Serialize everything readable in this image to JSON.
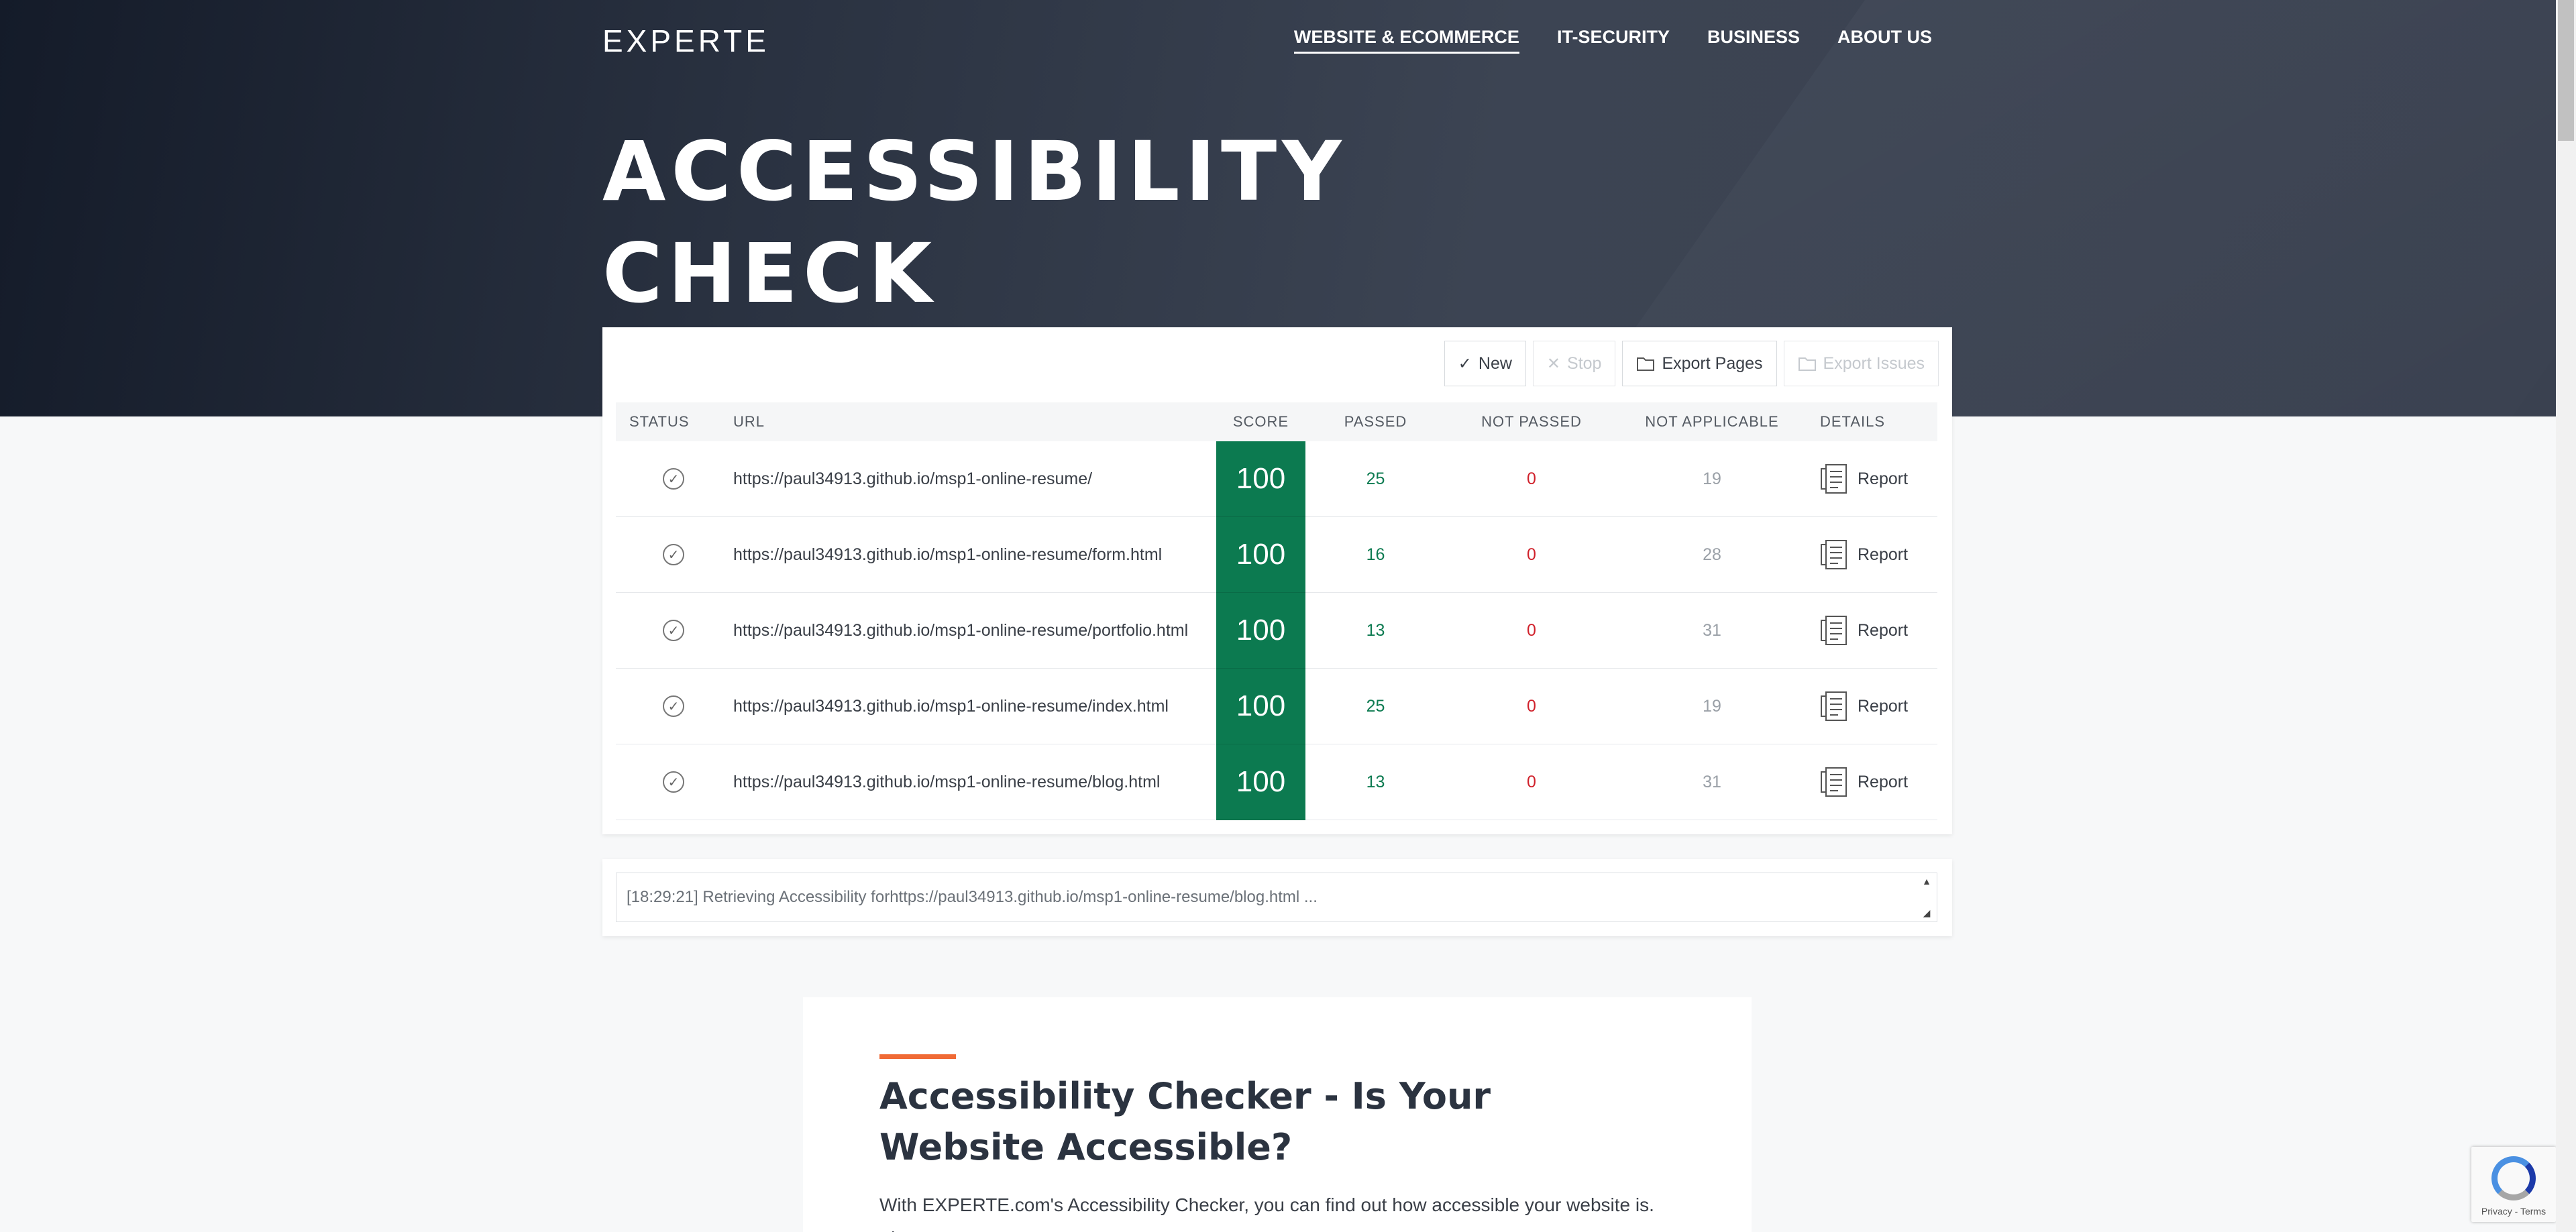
{
  "header": {
    "logo": "EXPERTE",
    "nav": [
      "WEBSITE & ECOMMERCE",
      "IT-SECURITY",
      "BUSINESS",
      "ABOUT US"
    ],
    "title": "ACCESSIBILITY CHECK"
  },
  "toolbar": {
    "new": "New",
    "stop": "Stop",
    "export_pages": "Export Pages",
    "export_issues": "Export Issues"
  },
  "table": {
    "headers": {
      "status": "STATUS",
      "url": "URL",
      "score": "SCORE",
      "passed": "PASSED",
      "not_passed": "NOT PASSED",
      "not_applicable": "NOT APPLICABLE",
      "details": "DETAILS"
    },
    "rows": [
      {
        "url": "https://paul34913.github.io/msp1-online-resume/",
        "score": "100",
        "passed": "25",
        "not_passed": "0",
        "not_applicable": "19",
        "details": "Report"
      },
      {
        "url": "https://paul34913.github.io/msp1-online-resume/form.html",
        "score": "100",
        "passed": "16",
        "not_passed": "0",
        "not_applicable": "28",
        "details": "Report"
      },
      {
        "url": "https://paul34913.github.io/msp1-online-resume/portfolio.html",
        "score": "100",
        "passed": "13",
        "not_passed": "0",
        "not_applicable": "31",
        "details": "Report"
      },
      {
        "url": "https://paul34913.github.io/msp1-online-resume/index.html",
        "score": "100",
        "passed": "25",
        "not_passed": "0",
        "not_applicable": "19",
        "details": "Report"
      },
      {
        "url": "https://paul34913.github.io/msp1-online-resume/blog.html",
        "score": "100",
        "passed": "13",
        "not_passed": "0",
        "not_applicable": "31",
        "details": "Report"
      }
    ]
  },
  "log": {
    "text": "[18:29:21] Retrieving Accessibility forhttps://paul34913.github.io/msp1-online-resume/blog.html ..."
  },
  "article": {
    "title": "Accessibility Checker - Is Your Website Accessible?",
    "text": "With EXPERTE.com's Accessibility Checker, you can find out how accessible your website is. The"
  },
  "recaptcha": {
    "text": "Privacy - Terms"
  },
  "colors": {
    "score_bg": "#0c7a50",
    "passed": "#0c7a50",
    "not_passed": "#d0202a",
    "accent": "#f06a35"
  }
}
